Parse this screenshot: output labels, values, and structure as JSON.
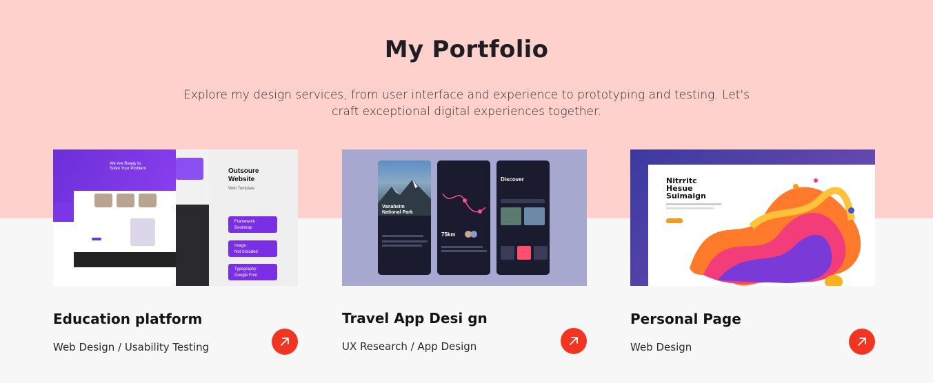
{
  "header": {
    "title": "My Portfolio",
    "intro": "Explore my design services, from user interface and experience to prototyping and testing. Let's craft exceptional digital experiences together."
  },
  "cards": [
    {
      "title": "Education platform",
      "tags": "Web Design / Usability Testing",
      "thumb_text": {
        "hero": "We Are Ready to Solve Your Problem",
        "side_title": "Outsoure Website",
        "side_sub": "Web Template",
        "pills": [
          {
            "k": "Framework :",
            "v": "Bootstrap"
          },
          {
            "k": "Image :",
            "v": "Not Included"
          },
          {
            "k": "Typography :",
            "v": "Google Font"
          }
        ]
      },
      "arrow_icon": "arrow-up-right-icon"
    },
    {
      "title": "Travel App Desi gn",
      "tags": "UX Research / App Design",
      "thumb_text": {
        "park": "Vanaheim National Park",
        "distance": "75km",
        "discover": "Discover"
      },
      "arrow_icon": "arrow-up-right-icon"
    },
    {
      "title": "Personal Page",
      "tags": "Web Design",
      "thumb_text": {
        "headline": "Nitrritc Hesue Suimaign"
      },
      "arrow_icon": "arrow-up-right-icon"
    }
  ],
  "colors": {
    "top_band": "#ffd1cc",
    "background": "#f7f7f7",
    "accent": "#f13521"
  }
}
